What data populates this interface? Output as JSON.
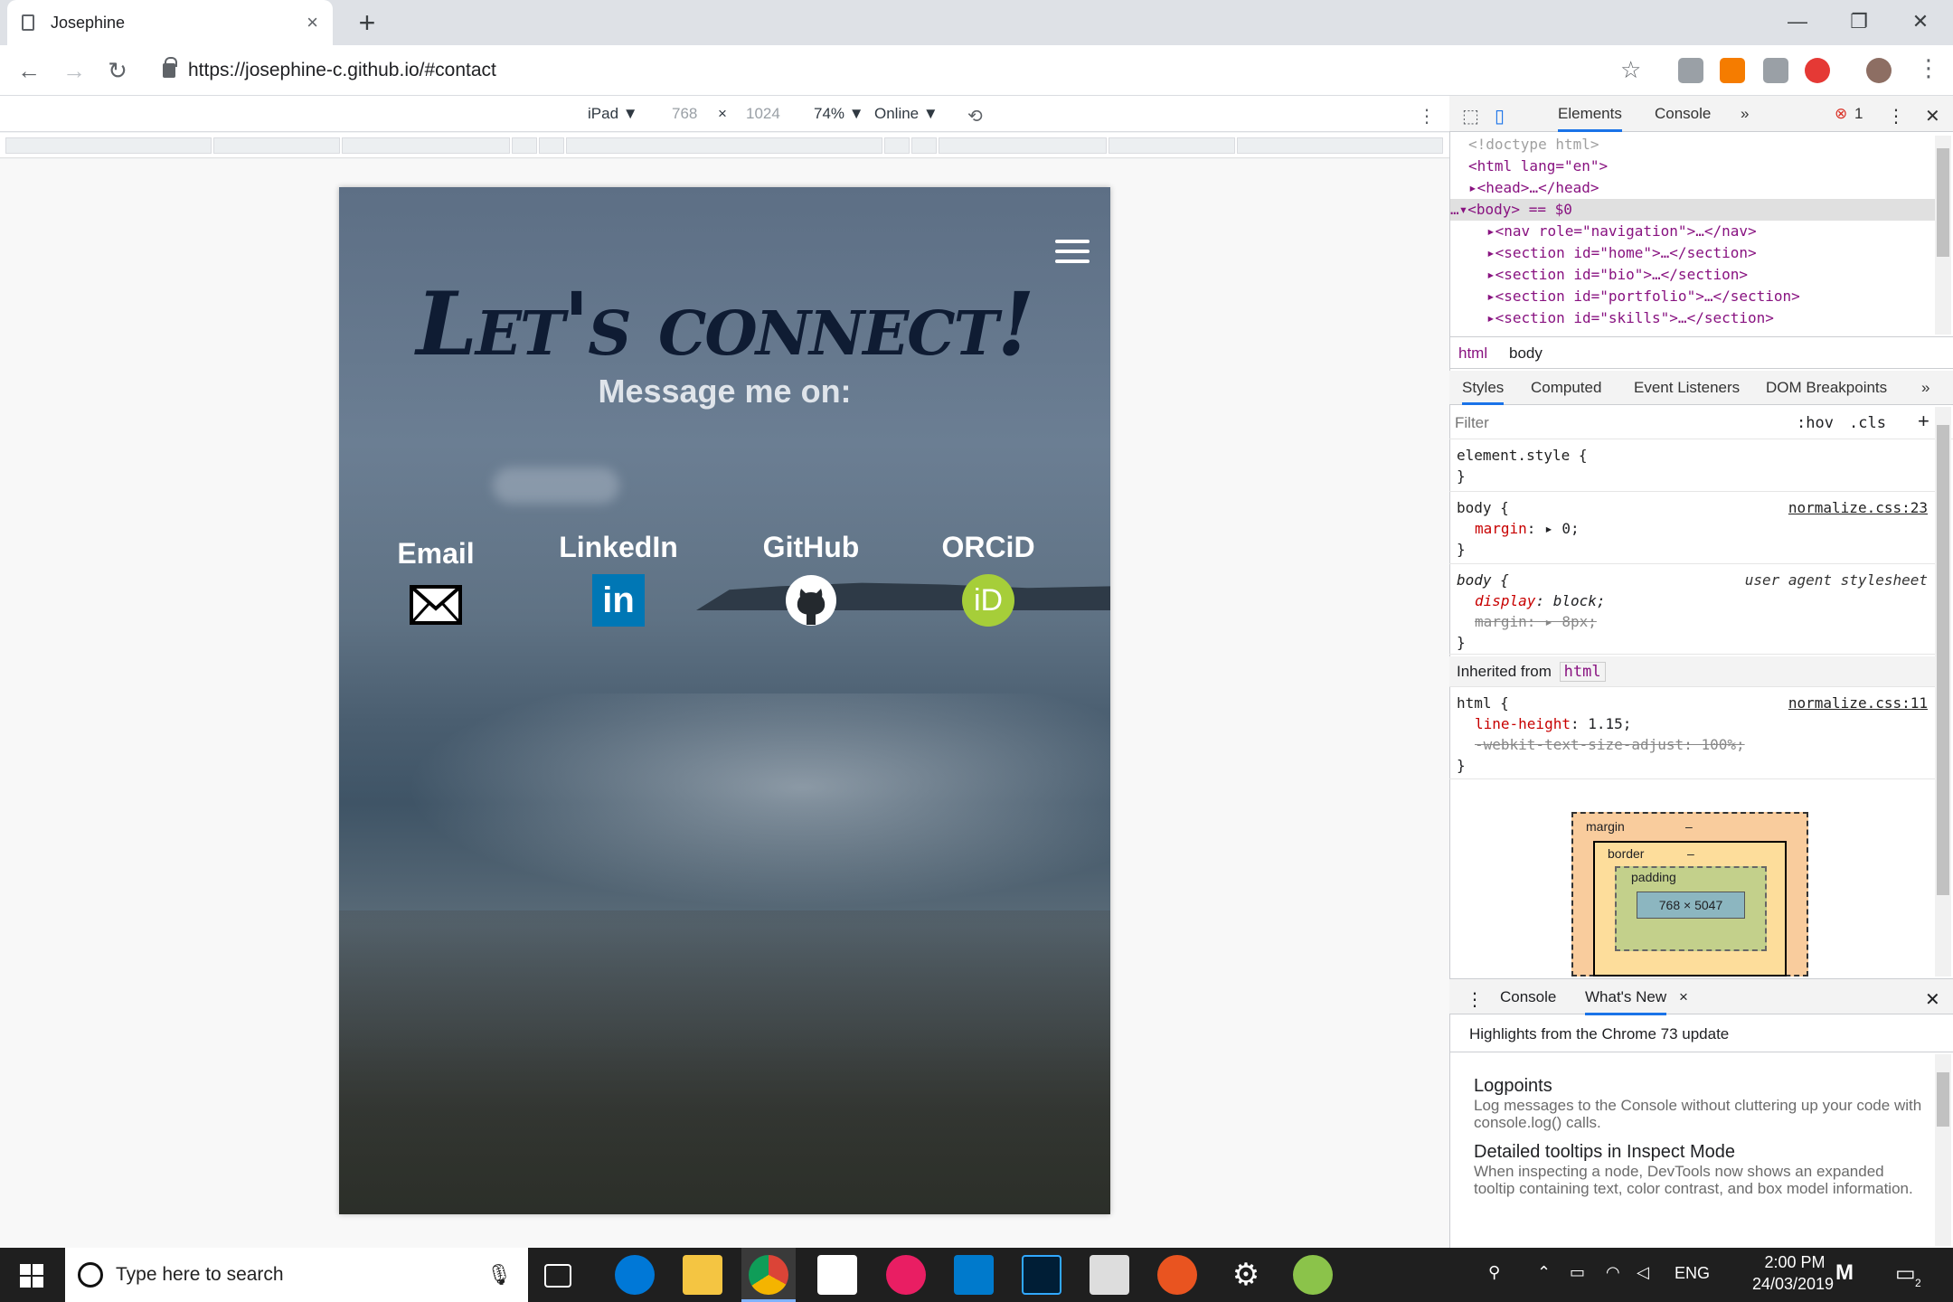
{
  "browser": {
    "tab_title": "Josephine",
    "tab_close": "×",
    "new_tab": "+",
    "url": "https://josephine-c.github.io/#contact",
    "window": {
      "minimize": "—",
      "restore": "❐",
      "close": "✕"
    }
  },
  "device_toolbar": {
    "device": "iPad ▼",
    "width": "768",
    "times": "×",
    "height": "1024",
    "zoom": "74% ▼",
    "network": "Online ▼"
  },
  "page": {
    "headline": "Let's connect!",
    "subhead": "Message me on:",
    "contacts": [
      {
        "label": "Email",
        "icon": "envelope-icon"
      },
      {
        "label": "LinkedIn",
        "icon": "linkedin-icon",
        "glyph": "in",
        "color": "#0077b5"
      },
      {
        "label": "GitHub",
        "icon": "github-icon"
      },
      {
        "label": "ORCiD",
        "icon": "orcid-icon",
        "glyph": "iD",
        "color": "#a6ce39"
      }
    ]
  },
  "devtools": {
    "tabs": {
      "elements": "Elements",
      "console": "Console",
      "more": "»",
      "errors": "1"
    },
    "dom": {
      "doctype": "<!doctype html>",
      "html_tag": "<html lang=\"en\">",
      "head": "<head>…</head>",
      "body": "<body> == $0",
      "nav": "<nav role=\"navigation\">…</nav>",
      "sec_home": "<section id=\"home\">…</section>",
      "sec_bio": "<section id=\"bio\">…</section>",
      "sec_portfolio": "<section id=\"portfolio\">…</section>",
      "sec_skills": "<section id=\"skills\">…</section>"
    },
    "breadcrumbs": [
      "html",
      "body"
    ],
    "styles_tabs": {
      "styles": "Styles",
      "computed": "Computed",
      "listeners": "Event Listeners",
      "dom_bp": "DOM Breakpoints",
      "more": "»"
    },
    "filter_placeholder": "Filter",
    "hov": ":hov",
    "cls": ".cls",
    "plus": "+",
    "rules": {
      "element_style": "element.style {",
      "close": "}",
      "body_sel": "body {",
      "normalize23": "normalize.css:23",
      "margin0_prop": "margin",
      "margin0_val": ": ▸ 0;",
      "ua_label": "user agent stylesheet",
      "display_prop": "display",
      "display_val": ": block;",
      "margin8": "margin: ▸ 8px;",
      "inherited_from": "Inherited from",
      "inherited_tag": "html",
      "html_sel": "html {",
      "normalize11": "normalize.css:11",
      "lh_prop": "line-height",
      "lh_val": ": 1.15;",
      "webkit": "-webkit-text-size-adjust: 100%;"
    },
    "box_model": {
      "margin": "margin",
      "border": "border",
      "padding": "padding",
      "dash": "–",
      "content": "768 × 5047"
    },
    "drawer": {
      "console": "Console",
      "whats_new": "What's New",
      "close": "×",
      "headline": "Highlights from the Chrome 73 update",
      "items": [
        {
          "title": "Logpoints",
          "desc": "Log messages to the Console without cluttering up your code with console.log() calls."
        },
        {
          "title": "Detailed tooltips in Inspect Mode",
          "desc": "When inspecting a node, DevTools now shows an expanded tooltip containing text, color contrast, and box model information."
        }
      ]
    }
  },
  "taskbar": {
    "search_placeholder": "Type here to search",
    "lang": "ENG",
    "time": "2:00 PM",
    "date": "24/03/2019",
    "notifications": "2"
  }
}
